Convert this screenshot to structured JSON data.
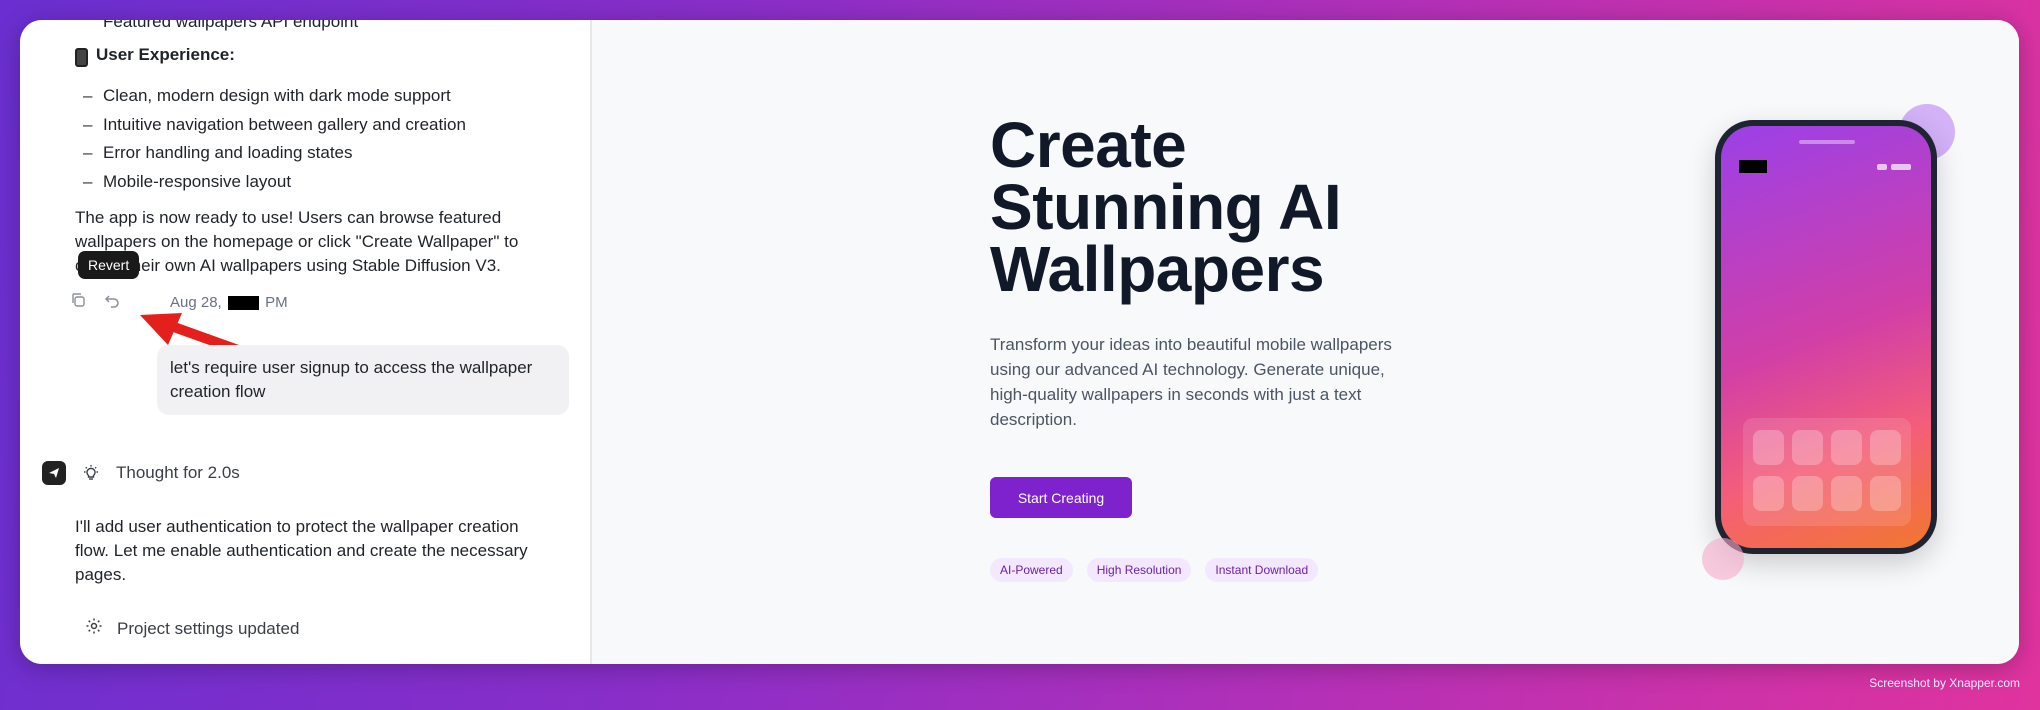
{
  "chat": {
    "clipped_line": "Featured wallpapers API endpoint",
    "section_title": "User Experience:",
    "bullets": [
      "Clean, modern design with dark mode support",
      "Intuitive navigation between gallery and creation",
      "Error handling and loading states",
      "Mobile-responsive layout"
    ],
    "summary": "The app is now ready to use! Users can browse featured wallpapers on the homepage or click \"Create Wallpaper\" to create their own AI wallpapers using Stable Diffusion V3.",
    "tooltip": "Revert",
    "timestamp_prefix": "Aug 28,",
    "timestamp_suffix": "PM",
    "user_message": "let's require user signup to access the wallpaper creation flow",
    "thought": "Thought for 2.0s",
    "response": "I'll add user authentication to protect the wallpaper creation flow. Let me enable authentication and create the necessary pages.",
    "settings_status": "Project settings updated",
    "icons": [
      "copy-icon",
      "undo-icon",
      "app-logo-icon",
      "lightbulb-icon",
      "gear-icon"
    ]
  },
  "preview": {
    "title_line1": "Create",
    "title_line2": "Stunning AI",
    "title_line3": "Wallpapers",
    "subtitle": "Transform your ideas into beautiful mobile wallpapers using our advanced AI technology. Generate unique, high-quality wallpapers in seconds with just a text description.",
    "cta": "Start Creating",
    "tags": [
      "AI-Powered",
      "High Resolution",
      "Instant Download"
    ],
    "accent_color": "#7e22ce"
  },
  "credit": "Screenshot by Xnapper.com"
}
